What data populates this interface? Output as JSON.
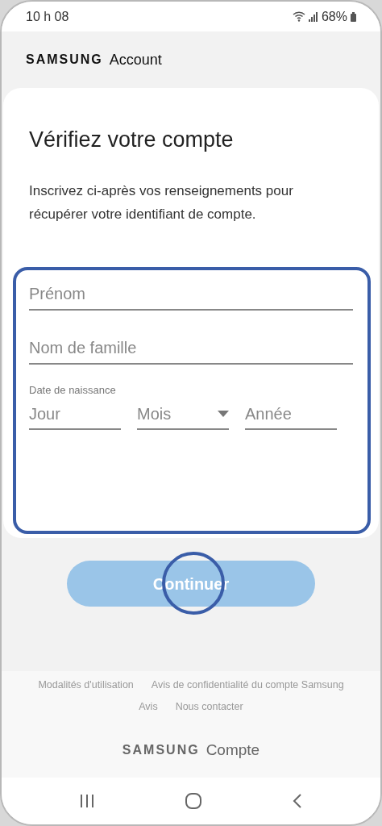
{
  "status_bar": {
    "time": "10 h 08",
    "battery": "68%"
  },
  "header": {
    "brand": "SAMSUNG",
    "title": "Account"
  },
  "card": {
    "title": "Vérifiez votre compte",
    "description": "Inscrivez ci-après vos renseignements pour récupérer votre identifiant de compte."
  },
  "fields": [
    {
      "placeholder": "Prénom"
    },
    {
      "placeholder": "Nom de famille"
    }
  ],
  "birth_date": {
    "label": "Date de naissance",
    "parts": [
      {
        "kind": "input",
        "placeholder": "Jour"
      },
      {
        "kind": "dropdown",
        "placeholder": "Mois"
      },
      {
        "kind": "input",
        "placeholder": "Année"
      }
    ]
  },
  "continue_button": {
    "label": "Continuer",
    "disabled": true
  },
  "footer": {
    "links": [
      [
        "Modalités d'utilisation",
        "Avis de confidentialité du compte Samsung"
      ],
      [
        "Avis",
        "Nous contacter"
      ]
    ],
    "brand": "SAMSUNG",
    "title": "Compte"
  }
}
